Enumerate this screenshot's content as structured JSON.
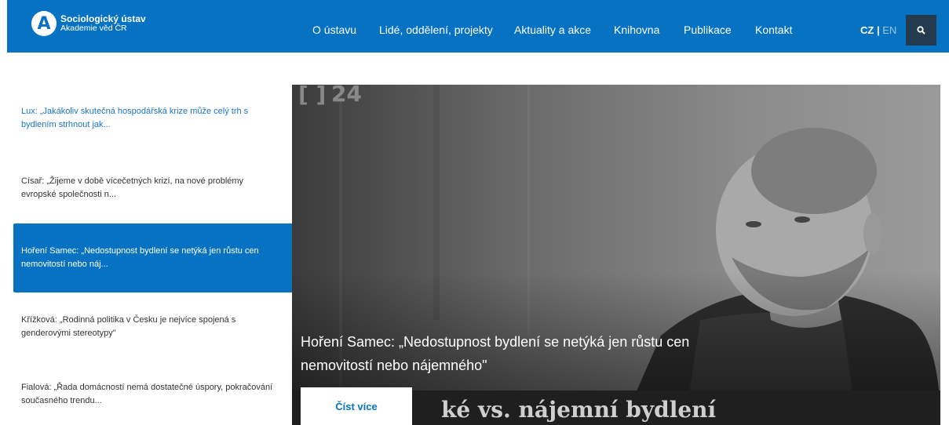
{
  "header": {
    "logo_title": "Sociologický ústav",
    "logo_subtitle": "Akademie věd ČR",
    "logo_letter": "A",
    "nav": [
      {
        "label": "O ústavu"
      },
      {
        "label": "Lidé, oddělení, projekty"
      },
      {
        "label": "Aktuality a akce"
      },
      {
        "label": "Knihovna"
      },
      {
        "label": "Publikace"
      },
      {
        "label": "Kontakt"
      }
    ],
    "lang_cz": "CZ",
    "lang_sep": " | ",
    "lang_en": "EN",
    "search_icon": "search-icon"
  },
  "news": [
    {
      "text": "Lux: „Jakákoliv skutečná hospodářská krize může celý trh s bydlením strhnout jak..."
    },
    {
      "text": "Císař: „Žijeme v době vícečetných krizí, na nové problémy evropské společnosti n..."
    },
    {
      "text": "Hoření Samec: „Nedostupnost bydlení se netýká jen růstu cen nemovitostí nebo náj..."
    },
    {
      "text": "Křížková: „Rodinná politika v Česku je nejvíce spojená s genderovými stereotypy\""
    },
    {
      "text": "Fialová: „Řada domácností nemá dostatečné úspory, pokračování současného trendu..."
    }
  ],
  "hero": {
    "logo_text": "24",
    "caption": "Hoření Samec: „Nedostupnost bydlení se netýká jen růstu cen nemovitostí nebo nájemného\"",
    "read_more": "Číst více",
    "banner_text": "ké vs. nájemní bydlení"
  },
  "colors": {
    "brand": "#0672c1",
    "search_bg": "#243a4f",
    "link": "#1a74c7"
  }
}
